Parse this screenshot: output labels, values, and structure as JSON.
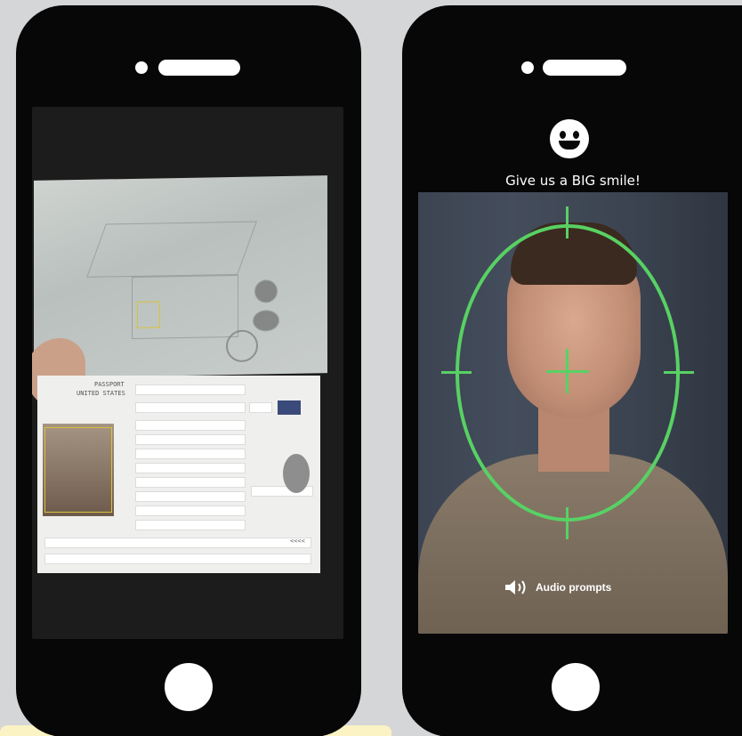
{
  "left_phone": {
    "document": {
      "header_label_1": "PASSPORT",
      "header_label_2": "UNITED STATES",
      "mrz_tail": "<<<<"
    }
  },
  "right_phone": {
    "prompt": "Give us a BIG smile!",
    "audio_prompts_label": "Audio prompts",
    "icons": [
      "smile-emoji-icon",
      "speaker-icon"
    ],
    "guide_color": "#58d164"
  }
}
